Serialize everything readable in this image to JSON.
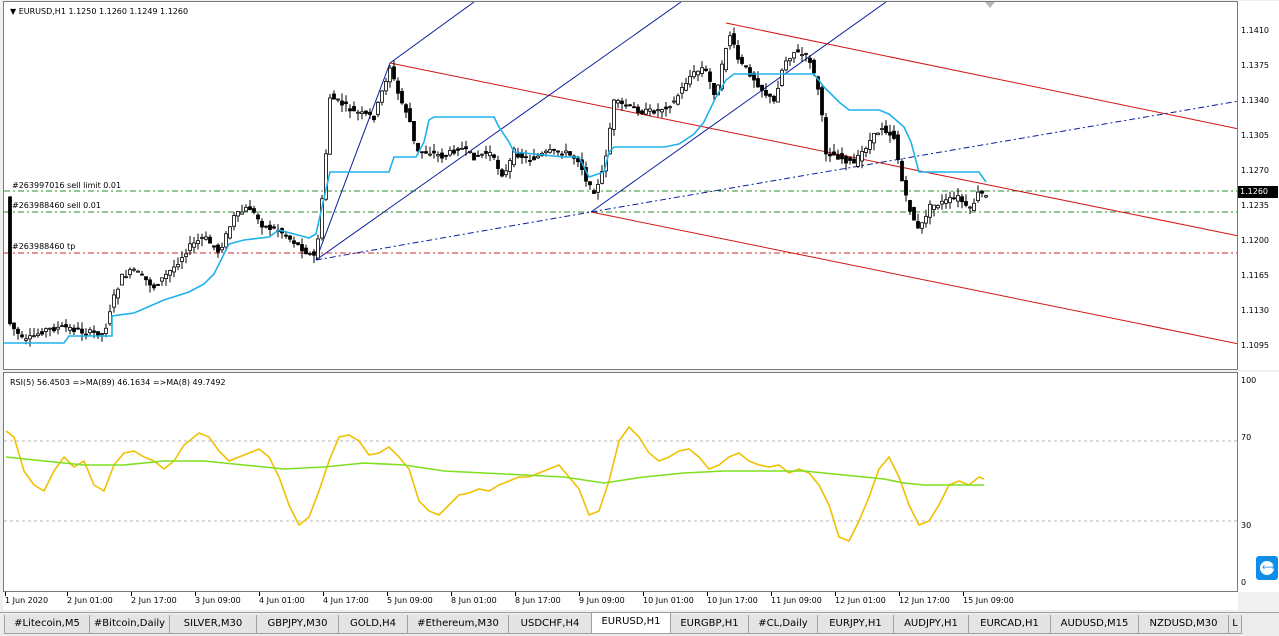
{
  "chart": {
    "title": "▼ EURUSD,H1  1.1250 1.1260 1.1249 1.1260",
    "current_price": "1.1260",
    "price_labels": [
      "1.1410",
      "1.1375",
      "1.1340",
      "1.1305",
      "1.1270",
      "1.1235",
      "1.1200",
      "1.1165",
      "1.1130",
      "1.1095"
    ],
    "orders": [
      {
        "label": "#263997016 sell limit 0.01",
        "color": "#2e8b2e"
      },
      {
        "label": "#263988460 sell 0.01",
        "color": "#2e8b2e"
      },
      {
        "label": "#263988460 tp",
        "color": "#cc2b2b"
      }
    ],
    "colors": {
      "candles": "#000000",
      "trail": "#1fb2ea",
      "channel": "#d21414",
      "blue_lines": "#0a1e9c"
    }
  },
  "rsi": {
    "title": "RSI(5) 56.4503  =>MA(89) 46.1634  =>MA(8) 49.7492",
    "levels": [
      "100",
      "70",
      "30",
      "0"
    ],
    "colors": {
      "rsi": "#f0c000",
      "ma": "#7ee020",
      "level": "#b8b8b8"
    }
  },
  "time_axis": [
    "1 Jun 2020",
    "2 Jun 01:00",
    "2 Jun 17:00",
    "3 Jun 09:00",
    "4 Jun 01:00",
    "4 Jun 17:00",
    "5 Jun 09:00",
    "8 Jun 01:00",
    "8 Jun 17:00",
    "9 Jun 09:00",
    "10 Jun 01:00",
    "10 Jun 17:00",
    "11 Jun 09:00",
    "12 Jun 01:00",
    "12 Jun 17:00",
    "15 Jun 09:00"
  ],
  "tabs": [
    {
      "label": "#Litecoin,M5",
      "active": false
    },
    {
      "label": "#Bitcoin,Daily",
      "active": false
    },
    {
      "label": "SILVER,M30",
      "active": false
    },
    {
      "label": "GBPJPY,M30",
      "active": false
    },
    {
      "label": "GOLD,H4",
      "active": false
    },
    {
      "label": "#Ethereum,M30",
      "active": false
    },
    {
      "label": "USDCHF,H4",
      "active": false
    },
    {
      "label": "EURUSD,H1",
      "active": true
    },
    {
      "label": "EURGBP,H1",
      "active": false
    },
    {
      "label": "#CL,Daily",
      "active": false
    },
    {
      "label": "EURJPY,H1",
      "active": false
    },
    {
      "label": "AUDJPY,H1",
      "active": false
    },
    {
      "label": "EURCAD,H1",
      "active": false
    },
    {
      "label": "AUDUSD,M15",
      "active": false
    },
    {
      "label": "NZDUSD,M30",
      "active": false
    },
    {
      "label": "L",
      "active": false
    }
  ]
}
